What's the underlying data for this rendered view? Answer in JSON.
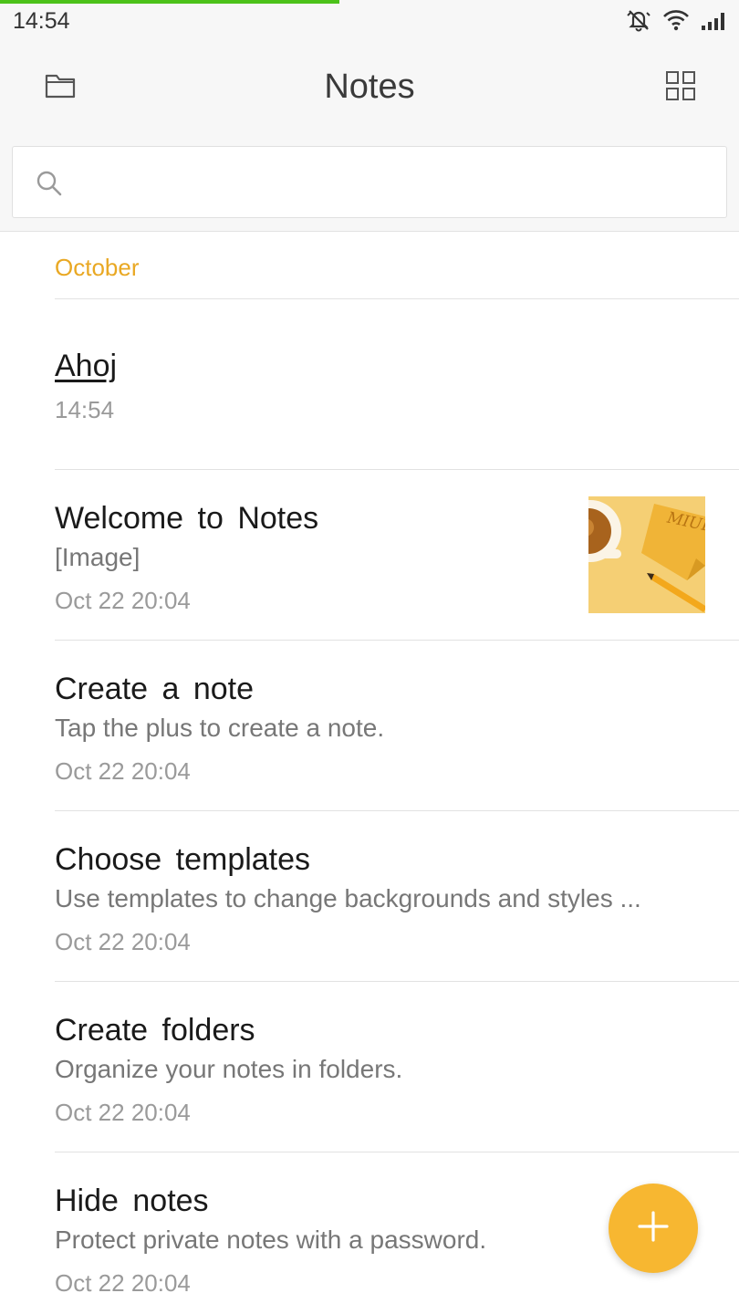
{
  "status_bar": {
    "time": "14:54",
    "icons": [
      "notifications-off-icon",
      "wifi-icon",
      "signal-icon"
    ]
  },
  "app_bar": {
    "title": "Notes",
    "left_icon": "folder-icon",
    "right_icon": "grid-view-icon"
  },
  "search": {
    "icon": "search-icon",
    "value": "",
    "placeholder": ""
  },
  "section": {
    "label": "October"
  },
  "notes": [
    {
      "title": "Ahoj",
      "snippet": "",
      "date": "14:54"
    },
    {
      "title": "Welcome to Notes",
      "snippet": "[Image]",
      "date": "Oct 22 20:04",
      "thumbnail_text": "MIUI"
    },
    {
      "title": "Create a note",
      "snippet": "Tap the plus to create a note.",
      "date": "Oct 22 20:04"
    },
    {
      "title": "Choose templates",
      "snippet": "Use templates to change backgrounds and styles ...",
      "date": "Oct 22 20:04"
    },
    {
      "title": "Create folders",
      "snippet": "Organize your notes in folders.",
      "date": "Oct 22 20:04"
    },
    {
      "title": "Hide notes",
      "snippet": "Protect private notes with a password.",
      "date": "Oct 22 20:04"
    }
  ],
  "fab": {
    "icon": "plus-icon"
  },
  "colors": {
    "accent": "#f7b731",
    "section_header": "#e9a823",
    "progress": "#4cc21a",
    "toolbar_bg": "#f7f7f7"
  }
}
